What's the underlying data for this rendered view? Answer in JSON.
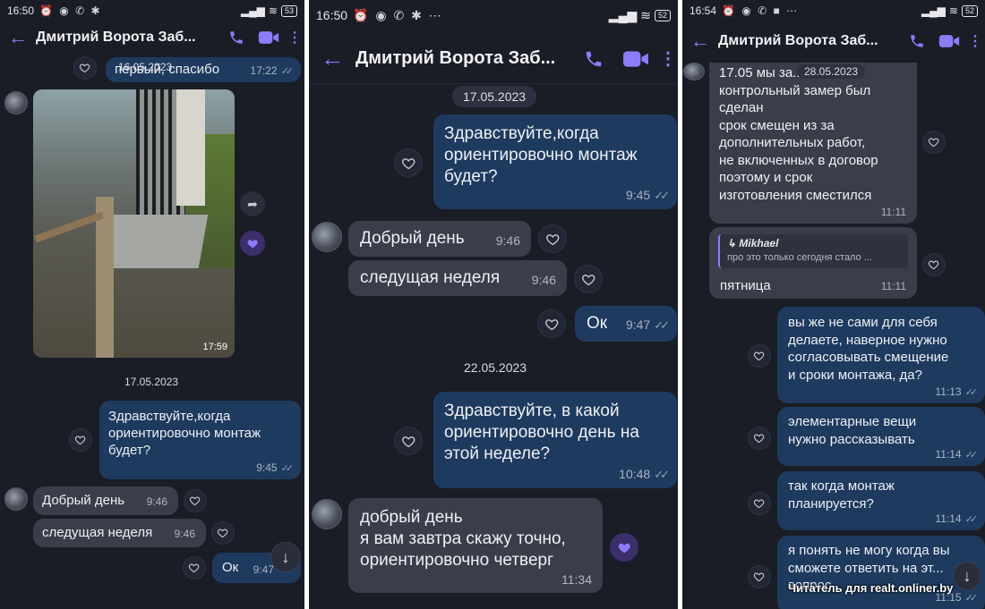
{
  "panel1": {
    "status_time": "16:50",
    "battery": "53",
    "chat_title": "Дмитрий Ворота Заб...",
    "overlap_date": "16.05.2023",
    "prev_msg": "первый, спасибо",
    "prev_time": "17:22",
    "photo_time": "17:59",
    "date_sep": "17.05.2023",
    "msg_q1": "Здравствуйте,когда\nориентировочно монтаж\nбудет?",
    "msg_q1_time": "9:45",
    "msg_a1": "Добрый день",
    "msg_a1_time": "9:46",
    "msg_a2": "следущая неделя",
    "msg_a2_time": "9:46",
    "msg_ok": "Ок",
    "msg_ok_time": "9:47"
  },
  "panel2": {
    "status_time": "16:50",
    "battery": "52",
    "chat_title": "Дмитрий Ворота Заб...",
    "date_sep1": "17.05.2023",
    "msg_q1": "Здравствуйте,когда\nориентировочно монтаж\nбудет?",
    "msg_q1_time": "9:45",
    "msg_a1": "Добрый день",
    "msg_a1_time": "9:46",
    "msg_a2": "следущая неделя",
    "msg_a2_time": "9:46",
    "msg_ok": "Ок",
    "msg_ok_time": "9:47",
    "date_sep2": "22.05.2023",
    "msg_q2": "Здравствуйте, в какой\nориентировочно день на\nэтой неделе?",
    "msg_q2_time": "10:48",
    "msg_a3": "добрый день\nя вам завтра скажу точно,\nориентировочно четверг",
    "msg_a3_time": "11:34"
  },
  "panel3": {
    "status_time": "16:54",
    "battery": "52",
    "chat_title": "Дмитрий Ворота Заб...",
    "overlap_date": "28.05.2023",
    "msg_in1": "17.05 мы за...\nконтрольный замер был\nсделан\nсрок смещен из за\nдополнительных работ,\nне включенных в договор\nпоэтому и срок\nизготовления сместился",
    "msg_in1_time": "11:11",
    "reply_author": "Mikhael",
    "reply_quote": "про это только сегодня стало ...",
    "reply_text": "пятница",
    "reply_time": "11:11",
    "msg_out1": "вы же не сами для себя\nделаете, наверное нужно\nсогласовывать смещение\nи сроки монтажа, да?",
    "msg_out1_time": "11:13",
    "msg_out2": "элементарные вещи\nнужно рассказывать",
    "msg_out2_time": "11:14",
    "msg_out3": "так когда монтаж\nпланируется?",
    "msg_out3_time": "11:14",
    "msg_out4": "я понять не могу когда вы\nсможете ответить на эт...\nвопрос",
    "msg_out4_time": "11:15"
  },
  "watermark": "Читатель для realt.onliner.by",
  "colors": {
    "background": "#1a1d26",
    "outgoing_bubble": "#1e3a5f",
    "incoming_bubble": "#3a3e4a",
    "accent": "#8c7cf6"
  }
}
